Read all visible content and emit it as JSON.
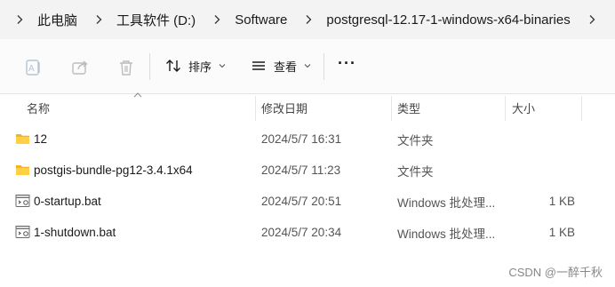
{
  "breadcrumb": {
    "items": [
      "此电脑",
      "工具软件 (D:)",
      "Software",
      "postgresql-12.17-1-windows-x64-binaries"
    ]
  },
  "toolbar": {
    "sort_label": "排序",
    "view_label": "查看",
    "more_label": "···"
  },
  "columns": {
    "name": "名称",
    "date": "修改日期",
    "type": "类型",
    "size": "大小"
  },
  "files": [
    {
      "name": "12",
      "date": "2024/5/7 16:31",
      "type": "文件夹",
      "size": "",
      "icon": "folder-icon"
    },
    {
      "name": "postgis-bundle-pg12-3.4.1x64",
      "date": "2024/5/7 11:23",
      "type": "文件夹",
      "size": "",
      "icon": "folder-icon"
    },
    {
      "name": "0-startup.bat",
      "date": "2024/5/7 20:51",
      "type": "Windows 批处理...",
      "size": "1 KB",
      "icon": "batch-file-icon"
    },
    {
      "name": "1-shutdown.bat",
      "date": "2024/5/7 20:34",
      "type": "Windows 批处理...",
      "size": "1 KB",
      "icon": "batch-file-icon"
    }
  ],
  "watermark": "CSDN @一醉千秋",
  "colors": {
    "folder": "#f4c430",
    "accent": "#1a1a1a"
  }
}
